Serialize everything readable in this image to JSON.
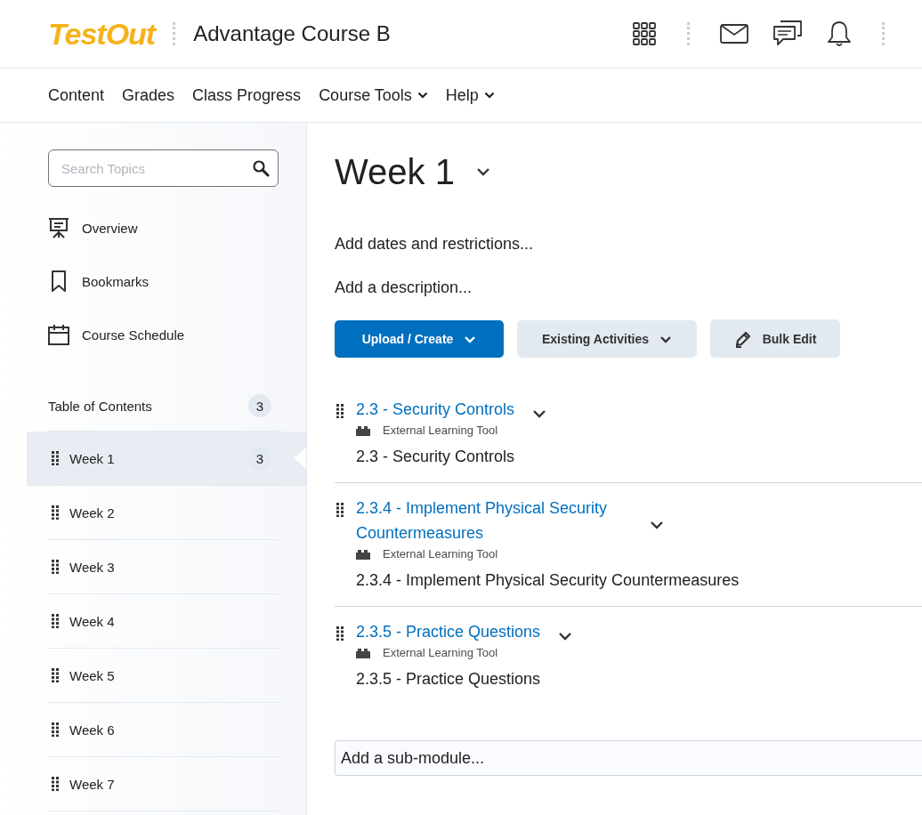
{
  "header": {
    "logo": "TestOut",
    "course_title": "Advantage Course B"
  },
  "nav": [
    {
      "label": "Content",
      "has_menu": false
    },
    {
      "label": "Grades",
      "has_menu": false
    },
    {
      "label": "Class Progress",
      "has_menu": false
    },
    {
      "label": "Course Tools",
      "has_menu": true
    },
    {
      "label": "Help",
      "has_menu": true
    }
  ],
  "sidebar": {
    "search": {
      "placeholder": "Search Topics"
    },
    "links": [
      {
        "kind": "overview",
        "label": "Overview"
      },
      {
        "kind": "bookmarks",
        "label": "Bookmarks"
      },
      {
        "kind": "schedule",
        "label": "Course Schedule"
      }
    ],
    "toc": {
      "label": "Table of Contents",
      "count": "3"
    },
    "modules": [
      {
        "label": "Week 1",
        "count": "3",
        "selected": true
      },
      {
        "label": "Week 2",
        "selected": false
      },
      {
        "label": "Week 3",
        "selected": false
      },
      {
        "label": "Week 4",
        "selected": false
      },
      {
        "label": "Week 5",
        "selected": false
      },
      {
        "label": "Week 6",
        "selected": false
      },
      {
        "label": "Week 7",
        "selected": false
      }
    ]
  },
  "main": {
    "title": "Week 1",
    "dates_link": "Add dates and restrictions...",
    "description_link": "Add a description...",
    "buttons": [
      {
        "kind": "primary",
        "label": "Upload / Create"
      },
      {
        "kind": "menu",
        "label": "Existing Activities"
      },
      {
        "kind": "edit",
        "label": "Bulk Edit"
      }
    ],
    "topics": [
      {
        "title": "2.3 - Security Controls",
        "type": "External Learning Tool",
        "description": "2.3 - Security Controls"
      },
      {
        "title": "2.3.4 - Implement Physical Security Countermeasures",
        "type": "External Learning Tool",
        "description": "2.3.4 - Implement Physical Security Countermeasures"
      },
      {
        "title": "2.3.5 - Practice Questions",
        "type": "External Learning Tool",
        "description": "2.3.5 - Practice Questions"
      }
    ],
    "submodule": {
      "placeholder": "Add a sub-module..."
    }
  }
}
